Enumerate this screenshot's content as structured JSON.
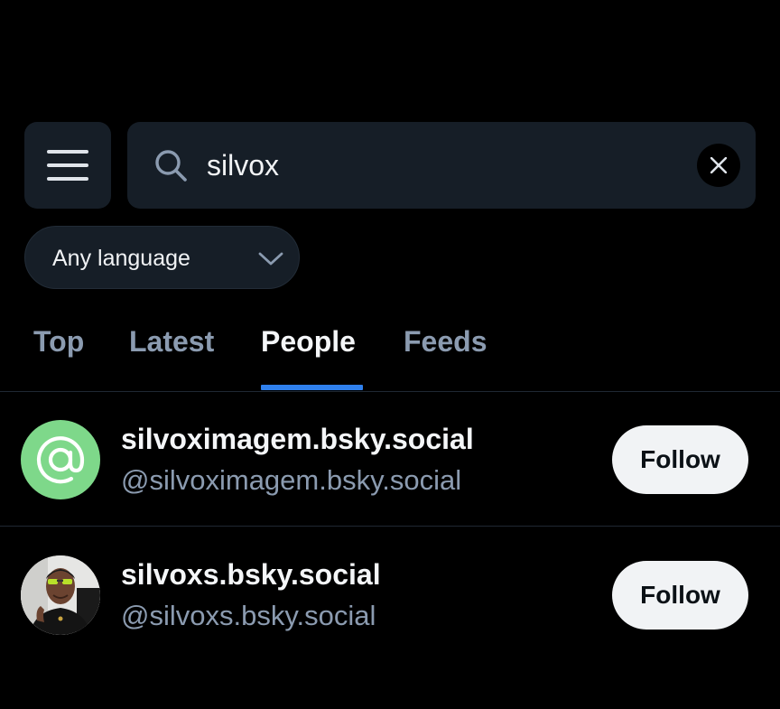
{
  "header": {
    "menu_icon": "hamburger-menu-icon"
  },
  "search": {
    "icon": "search-icon",
    "query": "silvox",
    "clear_icon": "close-icon"
  },
  "language_filter": {
    "selected": "Any language",
    "icon": "chevron-down-icon"
  },
  "tabs": [
    {
      "label": "Top",
      "active": false
    },
    {
      "label": "Latest",
      "active": false
    },
    {
      "label": "People",
      "active": true
    },
    {
      "label": "Feeds",
      "active": false
    }
  ],
  "results": [
    {
      "display_name": "silvoximagem.bsky.social",
      "handle": "@silvoximagem.bsky.social",
      "avatar": "default-at-avatar",
      "avatar_color": "#7ed88a",
      "follow_label": "Follow"
    },
    {
      "display_name": "silvoxs.bsky.social",
      "handle": "@silvoxs.bsky.social",
      "avatar": "user-photo-avatar",
      "follow_label": "Follow"
    }
  ],
  "colors": {
    "background": "#000000",
    "surface": "#161e27",
    "accent": "#2f80ed",
    "muted_text": "#8b9bb0",
    "primary_text": "#f4f6f8"
  }
}
